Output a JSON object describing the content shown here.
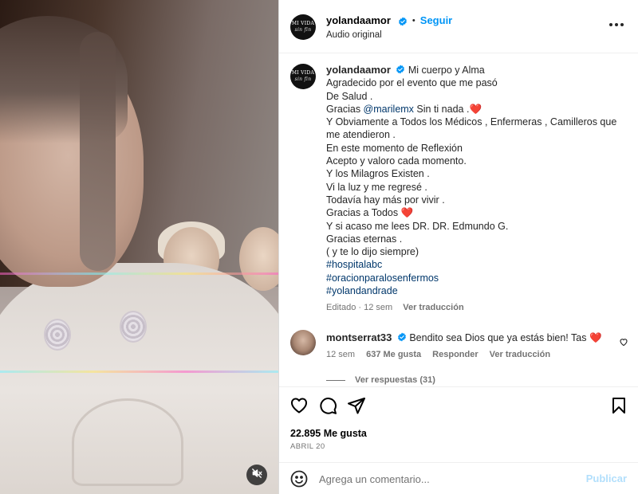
{
  "header": {
    "username": "yolandaamor",
    "separator": "•",
    "follow_label": "Seguir",
    "subtitle": "Audio original",
    "avatar_text_top": "MI VIDA",
    "avatar_text_bottom": "sin fin"
  },
  "caption": {
    "username": "yolandaamor",
    "first_line": "Mi cuerpo y Alma",
    "lines": [
      "Agradecido por el evento que me pasó",
      "De Salud .",
      "Gracias ",
      "Y Obviamente a Todos los Médicos , Enfermeras , Camilleros que",
      "me atendieron .",
      "En este momento de Reflexión",
      "Acepto y valoro cada momento.",
      "Y los Milagros Existen .",
      "Vi la luz y me regresé .",
      "Todavía hay más por vivir .",
      "Gracias a Todos ",
      "Y si acaso me lees DR. DR. Edmundo G.",
      "Gracias eternas .",
      "( y te lo dijo siempre)"
    ],
    "mention": "@marilemx",
    "mention_suffix": " Sin ti nada .",
    "heart": "❤️",
    "hashtags": [
      "#hospitalabc",
      "#oracionparalosenfermos",
      "#yolandandrade"
    ],
    "edited": "Editado",
    "time": "12 sem",
    "translate": "Ver traducción"
  },
  "comment": {
    "username": "montserrat33",
    "text": "Bendito sea Dios que ya estás bien! Tas",
    "heart": "❤️",
    "time": "12 sem",
    "likes": "637 Me gusta",
    "reply": "Responder",
    "translate": "Ver traducción",
    "view_replies": "Ver respuestas (31)"
  },
  "post": {
    "likes": "22.895 Me gusta",
    "date": "ABRIL 20"
  },
  "composer": {
    "placeholder": "Agrega un comentario...",
    "publish_label": "Publicar"
  },
  "colors": {
    "accent": "#0095f6",
    "link": "#00376b",
    "secondary_text": "#737373",
    "publish_disabled": "#b2dffc",
    "heart": "#e0245e"
  },
  "icons": [
    "verified-badge-icon",
    "more-options-icon",
    "heart-icon",
    "comment-icon",
    "share-icon",
    "bookmark-icon",
    "emoji-icon",
    "mute-icon",
    "comment-like-icon"
  ]
}
